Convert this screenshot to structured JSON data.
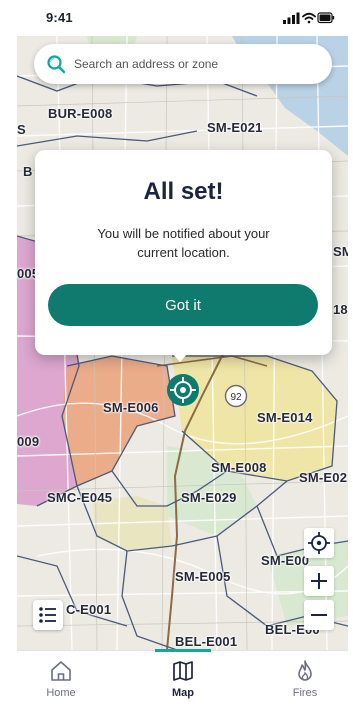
{
  "status_bar": {
    "time": "9:41"
  },
  "search": {
    "placeholder": "Search an address or zone"
  },
  "map": {
    "zones": [
      "BUR-E008",
      "SM-E021",
      "SM-E006",
      "SM-E014",
      "SM-E008",
      "SM-E02",
      "SMC-E045",
      "SM-E029",
      "SM-E005",
      "SM-E00",
      "C-E001",
      "BEL-E001",
      "BEL-E00",
      "009",
      "005",
      "S",
      "B",
      "SM",
      "18"
    ],
    "route_shield": "92",
    "zone_colors": {
      "pink": "#dca0cc",
      "orange": "#eba57f",
      "yellow": "#efe49e",
      "water": "#b9d2e6",
      "base": "#eceae3"
    }
  },
  "dialog": {
    "title": "All set!",
    "message": "You will be notified about your current location.",
    "button_label": "Got it"
  },
  "tab_bar": {
    "tabs": [
      {
        "label": "Home",
        "icon": "home-icon",
        "active": false
      },
      {
        "label": "Map",
        "icon": "map-icon",
        "active": true
      },
      {
        "label": "Fires",
        "icon": "fire-icon",
        "active": false
      }
    ],
    "accent_color": "#0e7b6e"
  }
}
